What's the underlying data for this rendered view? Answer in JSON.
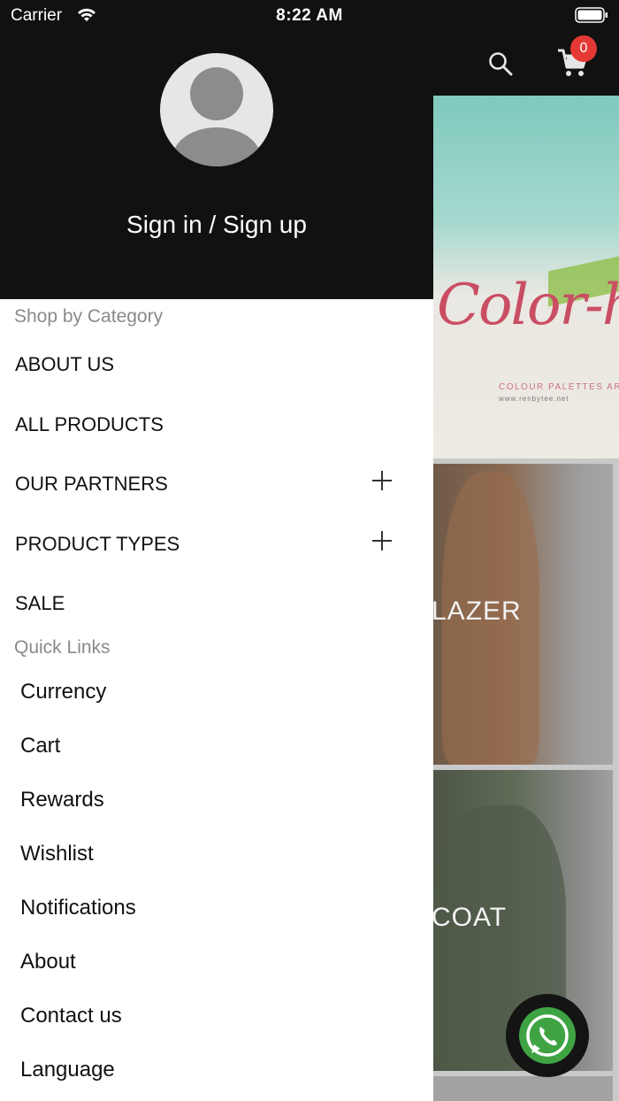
{
  "status_bar": {
    "carrier": "Carrier",
    "time": "8:22 AM"
  },
  "app_header": {
    "cart_count": "0"
  },
  "banner": {
    "script_text": "Color-h",
    "caption": "COLOUR PALETTES AR",
    "url": "www.renbytee.net"
  },
  "tiles": [
    {
      "label": "LAZER"
    },
    {
      "label": "COAT"
    }
  ],
  "drawer": {
    "signin_label": "Sign in / Sign up",
    "shop_title": "Shop by Category",
    "categories": [
      {
        "label": "ABOUT US",
        "expandable": false
      },
      {
        "label": "ALL PRODUCTS",
        "expandable": false
      },
      {
        "label": "OUR PARTNERS",
        "expandable": true
      },
      {
        "label": "PRODUCT TYPES",
        "expandable": true
      },
      {
        "label": "SALE",
        "expandable": false
      }
    ],
    "quick_links_title": "Quick Links",
    "quick_links": [
      {
        "label": "Currency"
      },
      {
        "label": "Cart"
      },
      {
        "label": "Rewards"
      },
      {
        "label": "Wishlist"
      },
      {
        "label": "Notifications"
      },
      {
        "label": "About"
      },
      {
        "label": "Contact us"
      },
      {
        "label": "Language"
      }
    ]
  },
  "colors": {
    "header_bg": "#111111",
    "badge": "#e53935",
    "whatsapp_green": "#3fa344",
    "section_gray": "#8a8a8a"
  }
}
